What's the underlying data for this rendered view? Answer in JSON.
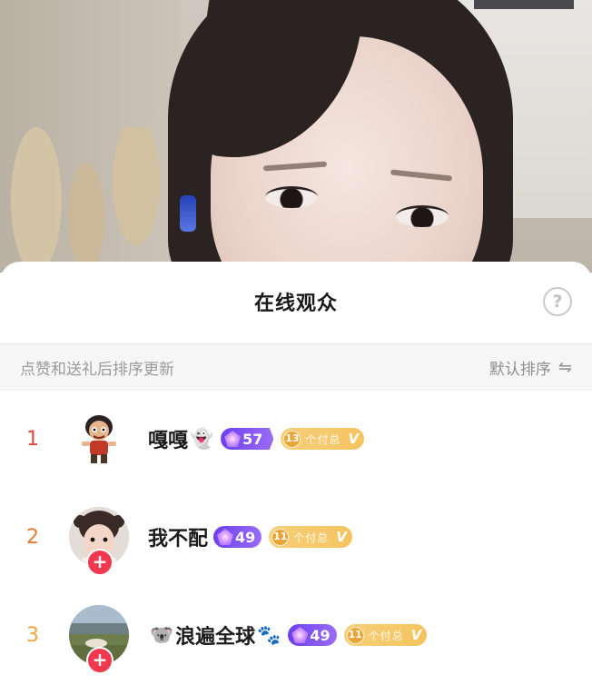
{
  "sheet": {
    "title": "在线观众",
    "help_icon": "question-circle-icon",
    "help_glyph": "?"
  },
  "sort_bar": {
    "hint": "点赞和送礼后排序更新",
    "sort_label": "默认排序",
    "sort_icon": "swap-arrows-icon",
    "sort_glyph": "⇋"
  },
  "colors": {
    "rank_1": "#e9433d",
    "rank_2": "#ef7a2b",
    "rank_3": "#f0a838",
    "follow_button": "#f0384f",
    "level_badge": "#7b4cf2",
    "fan_badge": "#f5c866"
  },
  "viewers": [
    {
      "rank": "1",
      "name": "嘎嘎",
      "name_emoji": "👻",
      "level": "57",
      "fan_level": "13",
      "fan_club": "个付总",
      "verified": "V",
      "has_follow_button": false
    },
    {
      "rank": "2",
      "name": "我不配",
      "name_emoji": "",
      "level": "49",
      "fan_level": "11",
      "fan_club": "个付总",
      "verified": "V",
      "has_follow_button": true
    },
    {
      "rank": "3",
      "name": "浪遍全球",
      "name_emoji_before": "🐨",
      "name_emoji": "🐾",
      "level": "49",
      "fan_level": "11",
      "fan_club": "个付总",
      "verified": "V",
      "has_follow_button": true
    }
  ],
  "follow_glyph": "+"
}
